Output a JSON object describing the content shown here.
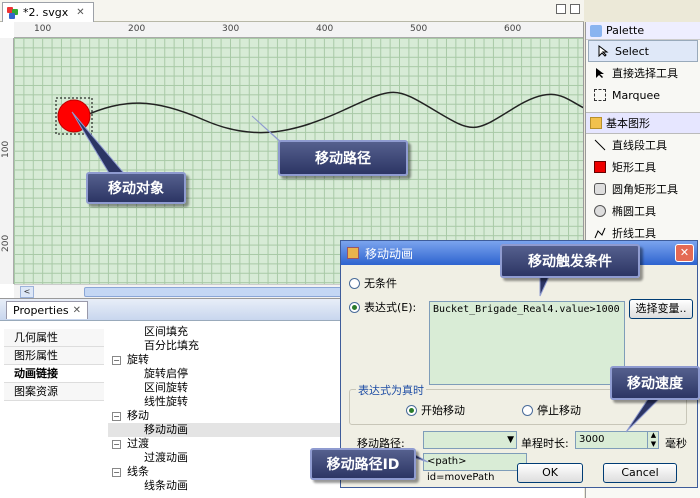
{
  "editor": {
    "tab_title": "*2. svgx",
    "close": "✕"
  },
  "ruler": {
    "top": [
      "100",
      "200",
      "300",
      "400",
      "500",
      "600"
    ],
    "left": [
      "100",
      "200"
    ]
  },
  "palette": {
    "title": "Palette",
    "items": [
      "Select",
      "直接选择工具",
      "Marquee"
    ],
    "group": "基本图形",
    "shapes": [
      "直线段工具",
      "矩形工具",
      "圆角矩形工具",
      "椭圆工具",
      "折线工具"
    ]
  },
  "properties": {
    "title": "Properties",
    "tabs": [
      "几何属性",
      "图形属性",
      "动画链接",
      "图案资源"
    ],
    "tree": [
      {
        "label": "区间填充",
        "type": "sub"
      },
      {
        "label": "百分比填充",
        "type": "sub"
      },
      {
        "label": "旋转",
        "type": "group"
      },
      {
        "label": "旋转启停",
        "type": "sub"
      },
      {
        "label": "区间旋转",
        "type": "sub"
      },
      {
        "label": "线性旋转",
        "type": "sub"
      },
      {
        "label": "移动",
        "type": "group"
      },
      {
        "label": "移动动画",
        "type": "sub"
      },
      {
        "label": "过渡",
        "type": "group"
      },
      {
        "label": "过渡动画",
        "type": "sub"
      },
      {
        "label": "线条",
        "type": "group"
      },
      {
        "label": "线条动画",
        "type": "sub"
      }
    ]
  },
  "dialog": {
    "title": "移动动画",
    "no_condition": "无条件",
    "expression_label": "表达式(E):",
    "expression_value": "Bucket_Brigade_Real4.value>1000",
    "select_var_button": "选择变量..",
    "group_label": "表达式为真时",
    "start_move": "开始移动",
    "stop_move": "停止移动",
    "path_label": "移动路径:",
    "duration_label": "单程时长:",
    "duration_value": "3000",
    "unit": "毫秒",
    "path_value": "<path> id=movePath",
    "ok": "OK",
    "cancel": "Cancel"
  },
  "callouts": {
    "move_object": "移动对象",
    "move_path": "移动路径",
    "trigger": "移动触发条件",
    "speed": "移动速度",
    "path_id": "移动路径ID"
  },
  "colors": {
    "callout_bg": "#2c3564",
    "grid": "#d7ebd6",
    "object": "#ff0000",
    "title_bar": "#2d63cf"
  }
}
